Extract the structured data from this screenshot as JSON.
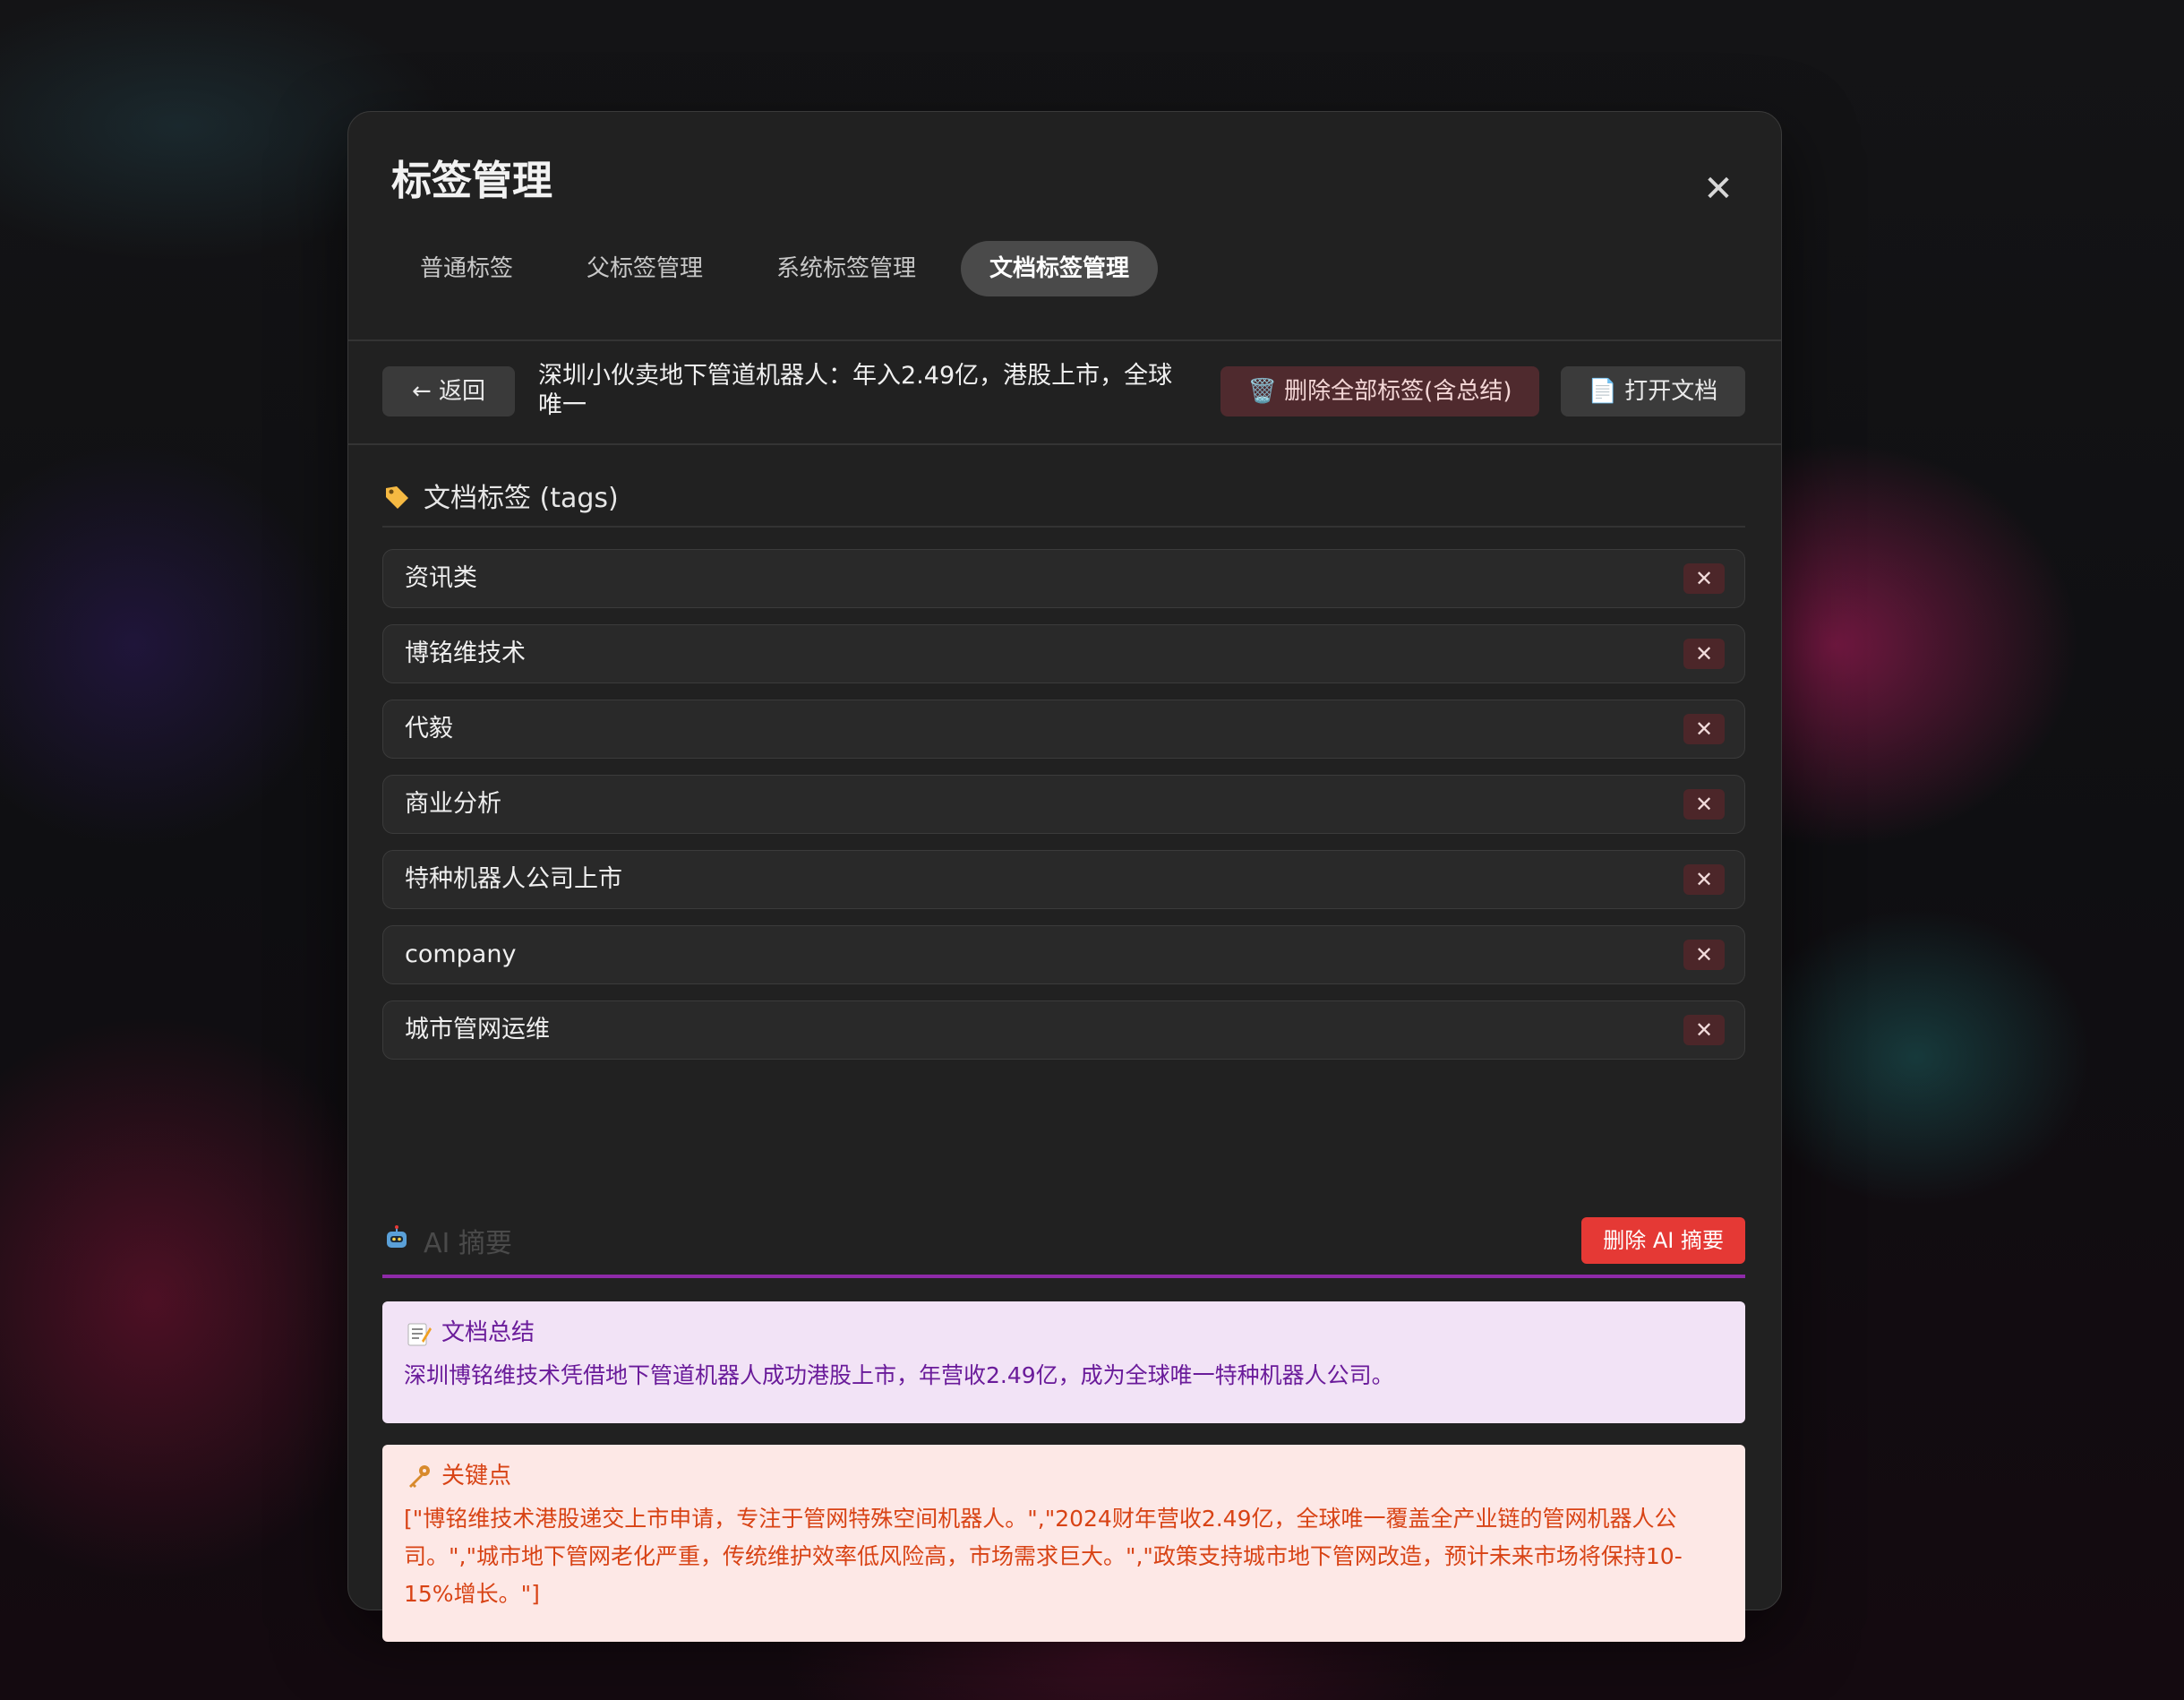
{
  "modal": {
    "title": "标签管理",
    "close_glyph": "✕",
    "tabs": [
      {
        "label": "普通标签",
        "active": false
      },
      {
        "label": "父标签管理",
        "active": false
      },
      {
        "label": "系统标签管理",
        "active": false
      },
      {
        "label": "文档标签管理",
        "active": true
      }
    ]
  },
  "toolbar": {
    "back_label": "← 返回",
    "doc_title": "深圳小伙卖地下管道机器人：年入2.49亿，港股上市，全球唯一",
    "delete_all_label": "🗑️ 删除全部标签(含总结)",
    "open_doc_label": "📄 打开文档"
  },
  "tags_section": {
    "icon": "tag-icon",
    "heading": "文档标签 (tags)",
    "remove_glyph": "✕",
    "items": [
      "资讯类",
      "博铭维技术",
      "代毅",
      "商业分析",
      "特种机器人公司上市",
      "company",
      "城市管网运维"
    ]
  },
  "ai_section": {
    "icon": "robot-icon",
    "heading": "AI 摘要",
    "delete_label": "删除 AI 摘要",
    "accent_color": "#8e2aa8",
    "summary": {
      "icon": "memo-icon",
      "title": "文档总结",
      "body": "深圳博铭维技术凭借地下管道机器人成功港股上市，年营收2.49亿，成为全球唯一特种机器人公司。"
    },
    "key_points": {
      "icon": "key-icon",
      "title": "关键点",
      "body": "[\"博铭维技术港股递交上市申请，专注于管网特殊空间机器人。\",\"2024财年营收2.49亿，全球唯一覆盖全产业链的管网机器人公司。\",\"城市地下管网老化严重，传统维护效率低风险高，市场需求巨大。\",\"政策支持城市地下管网改造，预计未来市场将保持10-15%增长。\"]"
    }
  },
  "colors": {
    "delete_red": "#e53935",
    "summary_text": "#6a1b9a",
    "keypoint_text": "#d84315"
  }
}
